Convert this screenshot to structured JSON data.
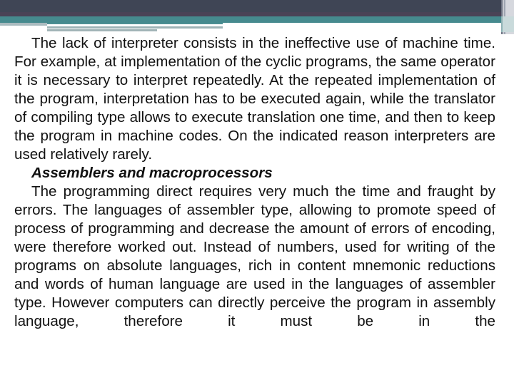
{
  "slide": {
    "colors": {
      "header_dark": "#3f4555",
      "teal_accent": "#468a8e",
      "text": "#111111",
      "background": "#ffffff"
    },
    "paragraphs": [
      {
        "text": "The lack of interpreter consists in the ineffective use of machine time. For example, at implementation of the cyclic programs, the same operator it is necessary to interpret repeatedly. At the repeated implementation of the program, interpretation has to be executed again, while the translator of compiling type allows to execute translation one time, and then to keep the program in machine codes. On the indicated reason interpreters are used relatively rarely."
      }
    ],
    "subheading": "Assemblers and macroprocessors",
    "paragraphs_after": [
      {
        "text": "The programming direct requires very much the time and fraught by errors. The languages of assembler type, allowing to promote speed of process of programming and decrease the amount of errors of encoding, were therefore worked out. Instead of numbers, used for writing of the programs on absolute languages, rich in content mnemonic reductions and words of human language are used in the languages of assembler type. However computers can directly perceive the program in assembly language, therefore it must be in the"
      }
    ]
  }
}
